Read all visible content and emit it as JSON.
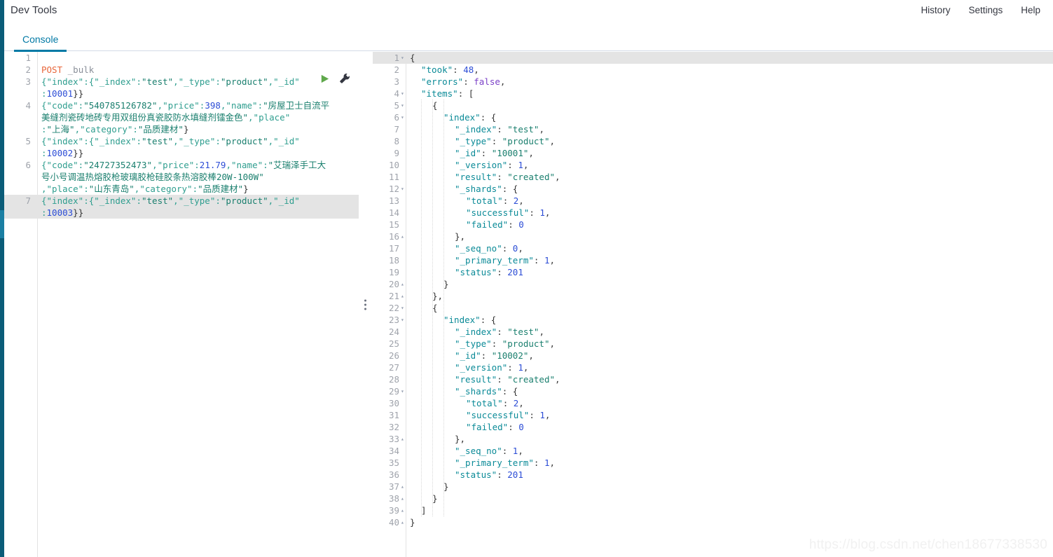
{
  "header": {
    "app_title": "Dev Tools",
    "nav": [
      {
        "label": "History",
        "name": "history"
      },
      {
        "label": "Settings",
        "name": "settings"
      },
      {
        "label": "Help",
        "name": "help"
      }
    ]
  },
  "tabs": [
    {
      "label": "Console",
      "active": true
    }
  ],
  "colors": {
    "rail": "#0b5c78",
    "accent": "#0079a5",
    "active_line": "#e4e4e4",
    "play_icon": "#5fa84b",
    "method": "#e8663a",
    "gutter_text": "#9fa3ab"
  },
  "icons": {
    "play": "play-icon",
    "wrench": "wrench-icon",
    "splitter": "drag-handle-icon"
  },
  "request_editor": {
    "name": "request-editor",
    "active_line": 7,
    "lines": [
      {
        "n": 1,
        "segments": []
      },
      {
        "n": 2,
        "segments": [
          {
            "t": "POST",
            "c": "k-method"
          },
          {
            "t": " ",
            "c": "k-punct"
          },
          {
            "t": "_bulk",
            "c": "k-path"
          }
        ]
      },
      {
        "n": 3,
        "segments": [
          {
            "t": "{\"index\":{\"_index\":",
            "c": "k-key"
          },
          {
            "t": "\"test\"",
            "c": "k-str"
          },
          {
            "t": ",\"_type\":",
            "c": "k-key"
          },
          {
            "t": "\"product\"",
            "c": "k-str"
          },
          {
            "t": ",\"_id\"",
            "c": "k-key"
          }
        ],
        "wrap": [
          {
            "t": ":",
            "c": "k-key"
          },
          {
            "t": "10001",
            "c": "k-num"
          },
          {
            "t": "}}",
            "c": "k-brace"
          }
        ]
      },
      {
        "n": 4,
        "segments": [
          {
            "t": "{\"code\":",
            "c": "k-key"
          },
          {
            "t": "\"540785126782\"",
            "c": "k-str"
          },
          {
            "t": ",\"price\":",
            "c": "k-key"
          },
          {
            "t": "398",
            "c": "k-num"
          },
          {
            "t": ",\"name\":",
            "c": "k-key"
          },
          {
            "t": "\"房屋卫士自流平",
            "c": "k-str"
          }
        ],
        "wrap2": [
          {
            "t": "美缝剂瓷砖地砖专用双组份真瓷胶防水填缝剂镭金色\"",
            "c": "k-str"
          },
          {
            "t": ",\"place\"",
            "c": "k-key"
          }
        ],
        "wrap3": [
          {
            "t": ":",
            "c": "k-key"
          },
          {
            "t": "\"上海\"",
            "c": "k-str"
          },
          {
            "t": ",\"category\":",
            "c": "k-key"
          },
          {
            "t": "\"品质建材\"",
            "c": "k-str"
          },
          {
            "t": "}",
            "c": "k-brace"
          }
        ]
      },
      {
        "n": 5,
        "segments": [
          {
            "t": "{\"index\":{\"_index\":",
            "c": "k-key"
          },
          {
            "t": "\"test\"",
            "c": "k-str"
          },
          {
            "t": ",\"_type\":",
            "c": "k-key"
          },
          {
            "t": "\"product\"",
            "c": "k-str"
          },
          {
            "t": ",\"_id\"",
            "c": "k-key"
          }
        ],
        "wrap": [
          {
            "t": ":",
            "c": "k-key"
          },
          {
            "t": "10002",
            "c": "k-num"
          },
          {
            "t": "}}",
            "c": "k-brace"
          }
        ]
      },
      {
        "n": 6,
        "segments": [
          {
            "t": "{\"code\":",
            "c": "k-key"
          },
          {
            "t": "\"24727352473\"",
            "c": "k-str"
          },
          {
            "t": ",\"price\":",
            "c": "k-key"
          },
          {
            "t": "21.79",
            "c": "k-num"
          },
          {
            "t": ",\"name\":",
            "c": "k-key"
          },
          {
            "t": "\"艾瑞泽手工大",
            "c": "k-str"
          }
        ],
        "wrap2": [
          {
            "t": "号小号调温热熔胶枪玻璃胶枪硅胶条热溶胶棒20W-100W\"",
            "c": "k-str"
          }
        ],
        "wrap3": [
          {
            "t": ",\"place\":",
            "c": "k-key"
          },
          {
            "t": "\"山东青岛\"",
            "c": "k-str"
          },
          {
            "t": ",\"category\":",
            "c": "k-key"
          },
          {
            "t": "\"品质建材\"",
            "c": "k-str"
          },
          {
            "t": "}",
            "c": "k-brace"
          }
        ]
      },
      {
        "n": 7,
        "segments": [
          {
            "t": "{\"index\":{\"_index\":",
            "c": "k-key"
          },
          {
            "t": "\"test\"",
            "c": "k-str"
          },
          {
            "t": ",\"_type\":",
            "c": "k-key"
          },
          {
            "t": "\"product\"",
            "c": "k-str"
          },
          {
            "t": ",\"_id\"",
            "c": "k-key"
          }
        ],
        "wrap": [
          {
            "t": ":",
            "c": "k-key"
          },
          {
            "t": "10003",
            "c": "k-num"
          },
          {
            "t": "}}",
            "c": "k-brace"
          }
        ]
      }
    ]
  },
  "response_editor": {
    "name": "response-editor",
    "active_line": 1,
    "lines": [
      {
        "n": 1,
        "fold": "down",
        "indent": 0,
        "segments": [
          {
            "t": "{",
            "c": "k-brace"
          }
        ]
      },
      {
        "n": 2,
        "indent": 1,
        "segments": [
          {
            "t": "\"took\"",
            "c": "k-rkey"
          },
          {
            "t": ": ",
            "c": "k-punct"
          },
          {
            "t": "48",
            "c": "k-rnum"
          },
          {
            "t": ",",
            "c": "k-punct"
          }
        ]
      },
      {
        "n": 3,
        "indent": 1,
        "segments": [
          {
            "t": "\"errors\"",
            "c": "k-rkey"
          },
          {
            "t": ": ",
            "c": "k-punct"
          },
          {
            "t": "false",
            "c": "k-bool"
          },
          {
            "t": ",",
            "c": "k-punct"
          }
        ]
      },
      {
        "n": 4,
        "fold": "down",
        "indent": 1,
        "segments": [
          {
            "t": "\"items\"",
            "c": "k-rkey"
          },
          {
            "t": ": ",
            "c": "k-punct"
          },
          {
            "t": "[",
            "c": "k-brace"
          }
        ]
      },
      {
        "n": 5,
        "fold": "down",
        "indent": 2,
        "segments": [
          {
            "t": "{",
            "c": "k-brace"
          }
        ]
      },
      {
        "n": 6,
        "fold": "down",
        "indent": 3,
        "segments": [
          {
            "t": "\"index\"",
            "c": "k-rkey"
          },
          {
            "t": ": ",
            "c": "k-punct"
          },
          {
            "t": "{",
            "c": "k-brace"
          }
        ]
      },
      {
        "n": 7,
        "indent": 4,
        "segments": [
          {
            "t": "\"_index\"",
            "c": "k-rkey"
          },
          {
            "t": ": ",
            "c": "k-punct"
          },
          {
            "t": "\"test\"",
            "c": "k-rstr"
          },
          {
            "t": ",",
            "c": "k-punct"
          }
        ]
      },
      {
        "n": 8,
        "indent": 4,
        "segments": [
          {
            "t": "\"_type\"",
            "c": "k-rkey"
          },
          {
            "t": ": ",
            "c": "k-punct"
          },
          {
            "t": "\"product\"",
            "c": "k-rstr"
          },
          {
            "t": ",",
            "c": "k-punct"
          }
        ]
      },
      {
        "n": 9,
        "indent": 4,
        "segments": [
          {
            "t": "\"_id\"",
            "c": "k-rkey"
          },
          {
            "t": ": ",
            "c": "k-punct"
          },
          {
            "t": "\"10001\"",
            "c": "k-rstr"
          },
          {
            "t": ",",
            "c": "k-punct"
          }
        ]
      },
      {
        "n": 10,
        "indent": 4,
        "segments": [
          {
            "t": "\"_version\"",
            "c": "k-rkey"
          },
          {
            "t": ": ",
            "c": "k-punct"
          },
          {
            "t": "1",
            "c": "k-rnum"
          },
          {
            "t": ",",
            "c": "k-punct"
          }
        ]
      },
      {
        "n": 11,
        "indent": 4,
        "segments": [
          {
            "t": "\"result\"",
            "c": "k-rkey"
          },
          {
            "t": ": ",
            "c": "k-punct"
          },
          {
            "t": "\"created\"",
            "c": "k-rstr"
          },
          {
            "t": ",",
            "c": "k-punct"
          }
        ]
      },
      {
        "n": 12,
        "fold": "down",
        "indent": 4,
        "segments": [
          {
            "t": "\"_shards\"",
            "c": "k-rkey"
          },
          {
            "t": ": ",
            "c": "k-punct"
          },
          {
            "t": "{",
            "c": "k-brace"
          }
        ]
      },
      {
        "n": 13,
        "indent": 5,
        "segments": [
          {
            "t": "\"total\"",
            "c": "k-rkey"
          },
          {
            "t": ": ",
            "c": "k-punct"
          },
          {
            "t": "2",
            "c": "k-rnum"
          },
          {
            "t": ",",
            "c": "k-punct"
          }
        ]
      },
      {
        "n": 14,
        "indent": 5,
        "segments": [
          {
            "t": "\"successful\"",
            "c": "k-rkey"
          },
          {
            "t": ": ",
            "c": "k-punct"
          },
          {
            "t": "1",
            "c": "k-rnum"
          },
          {
            "t": ",",
            "c": "k-punct"
          }
        ]
      },
      {
        "n": 15,
        "indent": 5,
        "segments": [
          {
            "t": "\"failed\"",
            "c": "k-rkey"
          },
          {
            "t": ": ",
            "c": "k-punct"
          },
          {
            "t": "0",
            "c": "k-rnum"
          }
        ]
      },
      {
        "n": 16,
        "fold": "up",
        "indent": 4,
        "segments": [
          {
            "t": "},",
            "c": "k-brace"
          }
        ]
      },
      {
        "n": 17,
        "indent": 4,
        "segments": [
          {
            "t": "\"_seq_no\"",
            "c": "k-rkey"
          },
          {
            "t": ": ",
            "c": "k-punct"
          },
          {
            "t": "0",
            "c": "k-rnum"
          },
          {
            "t": ",",
            "c": "k-punct"
          }
        ]
      },
      {
        "n": 18,
        "indent": 4,
        "segments": [
          {
            "t": "\"_primary_term\"",
            "c": "k-rkey"
          },
          {
            "t": ": ",
            "c": "k-punct"
          },
          {
            "t": "1",
            "c": "k-rnum"
          },
          {
            "t": ",",
            "c": "k-punct"
          }
        ]
      },
      {
        "n": 19,
        "indent": 4,
        "segments": [
          {
            "t": "\"status\"",
            "c": "k-rkey"
          },
          {
            "t": ": ",
            "c": "k-punct"
          },
          {
            "t": "201",
            "c": "k-rnum"
          }
        ]
      },
      {
        "n": 20,
        "fold": "up",
        "indent": 3,
        "segments": [
          {
            "t": "}",
            "c": "k-brace"
          }
        ]
      },
      {
        "n": 21,
        "fold": "up",
        "indent": 2,
        "segments": [
          {
            "t": "},",
            "c": "k-brace"
          }
        ]
      },
      {
        "n": 22,
        "fold": "down",
        "indent": 2,
        "segments": [
          {
            "t": "{",
            "c": "k-brace"
          }
        ]
      },
      {
        "n": 23,
        "fold": "down",
        "indent": 3,
        "segments": [
          {
            "t": "\"index\"",
            "c": "k-rkey"
          },
          {
            "t": ": ",
            "c": "k-punct"
          },
          {
            "t": "{",
            "c": "k-brace"
          }
        ]
      },
      {
        "n": 24,
        "indent": 4,
        "segments": [
          {
            "t": "\"_index\"",
            "c": "k-rkey"
          },
          {
            "t": ": ",
            "c": "k-punct"
          },
          {
            "t": "\"test\"",
            "c": "k-rstr"
          },
          {
            "t": ",",
            "c": "k-punct"
          }
        ]
      },
      {
        "n": 25,
        "indent": 4,
        "segments": [
          {
            "t": "\"_type\"",
            "c": "k-rkey"
          },
          {
            "t": ": ",
            "c": "k-punct"
          },
          {
            "t": "\"product\"",
            "c": "k-rstr"
          },
          {
            "t": ",",
            "c": "k-punct"
          }
        ]
      },
      {
        "n": 26,
        "indent": 4,
        "segments": [
          {
            "t": "\"_id\"",
            "c": "k-rkey"
          },
          {
            "t": ": ",
            "c": "k-punct"
          },
          {
            "t": "\"10002\"",
            "c": "k-rstr"
          },
          {
            "t": ",",
            "c": "k-punct"
          }
        ]
      },
      {
        "n": 27,
        "indent": 4,
        "segments": [
          {
            "t": "\"_version\"",
            "c": "k-rkey"
          },
          {
            "t": ": ",
            "c": "k-punct"
          },
          {
            "t": "1",
            "c": "k-rnum"
          },
          {
            "t": ",",
            "c": "k-punct"
          }
        ]
      },
      {
        "n": 28,
        "indent": 4,
        "segments": [
          {
            "t": "\"result\"",
            "c": "k-rkey"
          },
          {
            "t": ": ",
            "c": "k-punct"
          },
          {
            "t": "\"created\"",
            "c": "k-rstr"
          },
          {
            "t": ",",
            "c": "k-punct"
          }
        ]
      },
      {
        "n": 29,
        "fold": "down",
        "indent": 4,
        "segments": [
          {
            "t": "\"_shards\"",
            "c": "k-rkey"
          },
          {
            "t": ": ",
            "c": "k-punct"
          },
          {
            "t": "{",
            "c": "k-brace"
          }
        ]
      },
      {
        "n": 30,
        "indent": 5,
        "segments": [
          {
            "t": "\"total\"",
            "c": "k-rkey"
          },
          {
            "t": ": ",
            "c": "k-punct"
          },
          {
            "t": "2",
            "c": "k-rnum"
          },
          {
            "t": ",",
            "c": "k-punct"
          }
        ]
      },
      {
        "n": 31,
        "indent": 5,
        "segments": [
          {
            "t": "\"successful\"",
            "c": "k-rkey"
          },
          {
            "t": ": ",
            "c": "k-punct"
          },
          {
            "t": "1",
            "c": "k-rnum"
          },
          {
            "t": ",",
            "c": "k-punct"
          }
        ]
      },
      {
        "n": 32,
        "indent": 5,
        "segments": [
          {
            "t": "\"failed\"",
            "c": "k-rkey"
          },
          {
            "t": ": ",
            "c": "k-punct"
          },
          {
            "t": "0",
            "c": "k-rnum"
          }
        ]
      },
      {
        "n": 33,
        "fold": "up",
        "indent": 4,
        "segments": [
          {
            "t": "},",
            "c": "k-brace"
          }
        ]
      },
      {
        "n": 34,
        "indent": 4,
        "segments": [
          {
            "t": "\"_seq_no\"",
            "c": "k-rkey"
          },
          {
            "t": ": ",
            "c": "k-punct"
          },
          {
            "t": "1",
            "c": "k-rnum"
          },
          {
            "t": ",",
            "c": "k-punct"
          }
        ]
      },
      {
        "n": 35,
        "indent": 4,
        "segments": [
          {
            "t": "\"_primary_term\"",
            "c": "k-rkey"
          },
          {
            "t": ": ",
            "c": "k-punct"
          },
          {
            "t": "1",
            "c": "k-rnum"
          },
          {
            "t": ",",
            "c": "k-punct"
          }
        ]
      },
      {
        "n": 36,
        "indent": 4,
        "segments": [
          {
            "t": "\"status\"",
            "c": "k-rkey"
          },
          {
            "t": ": ",
            "c": "k-punct"
          },
          {
            "t": "201",
            "c": "k-rnum"
          }
        ]
      },
      {
        "n": 37,
        "fold": "up",
        "indent": 3,
        "segments": [
          {
            "t": "}",
            "c": "k-brace"
          }
        ]
      },
      {
        "n": 38,
        "fold": "up",
        "indent": 2,
        "segments": [
          {
            "t": "}",
            "c": "k-brace"
          }
        ]
      },
      {
        "n": 39,
        "fold": "up",
        "indent": 1,
        "segments": [
          {
            "t": "]",
            "c": "k-brace"
          }
        ]
      },
      {
        "n": 40,
        "fold": "up",
        "indent": 0,
        "segments": [
          {
            "t": "}",
            "c": "k-brace"
          }
        ]
      }
    ]
  },
  "response_data": {
    "took": 48,
    "errors": false,
    "items": [
      {
        "index": {
          "_index": "test",
          "_type": "product",
          "_id": "10001",
          "_version": 1,
          "result": "created",
          "_shards": {
            "total": 2,
            "successful": 1,
            "failed": 0
          },
          "_seq_no": 0,
          "_primary_term": 1,
          "status": 201
        }
      },
      {
        "index": {
          "_index": "test",
          "_type": "product",
          "_id": "10002",
          "_version": 1,
          "result": "created",
          "_shards": {
            "total": 2,
            "successful": 1,
            "failed": 0
          },
          "_seq_no": 1,
          "_primary_term": 1,
          "status": 201
        }
      }
    ]
  },
  "watermark": {
    "text": "https://blog.csdn.net/chen18677338530"
  }
}
